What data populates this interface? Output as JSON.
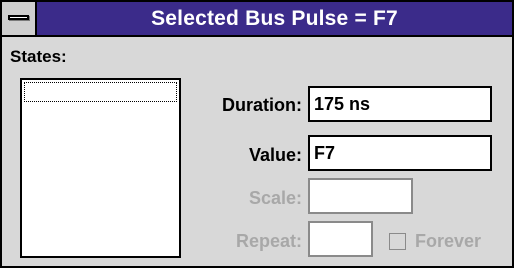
{
  "window": {
    "title": "Selected Bus Pulse = F7"
  },
  "states": {
    "label": "States:",
    "items": []
  },
  "fields": {
    "duration": {
      "label": "Duration:",
      "value": "175 ns",
      "enabled": true
    },
    "value": {
      "label": "Value:",
      "value": "F7",
      "enabled": true
    },
    "scale": {
      "label": "Scale:",
      "value": "",
      "enabled": false
    },
    "repeat": {
      "label": "Repeat:",
      "value": "",
      "enabled": false
    }
  },
  "forever": {
    "label": "Forever",
    "checked": false,
    "enabled": false
  },
  "colors": {
    "titlebar": "#3b2b8a",
    "title_text": "#ffffff",
    "dialog_bg": "#d8d8d8",
    "disabled_text": "#a8a8a8"
  }
}
